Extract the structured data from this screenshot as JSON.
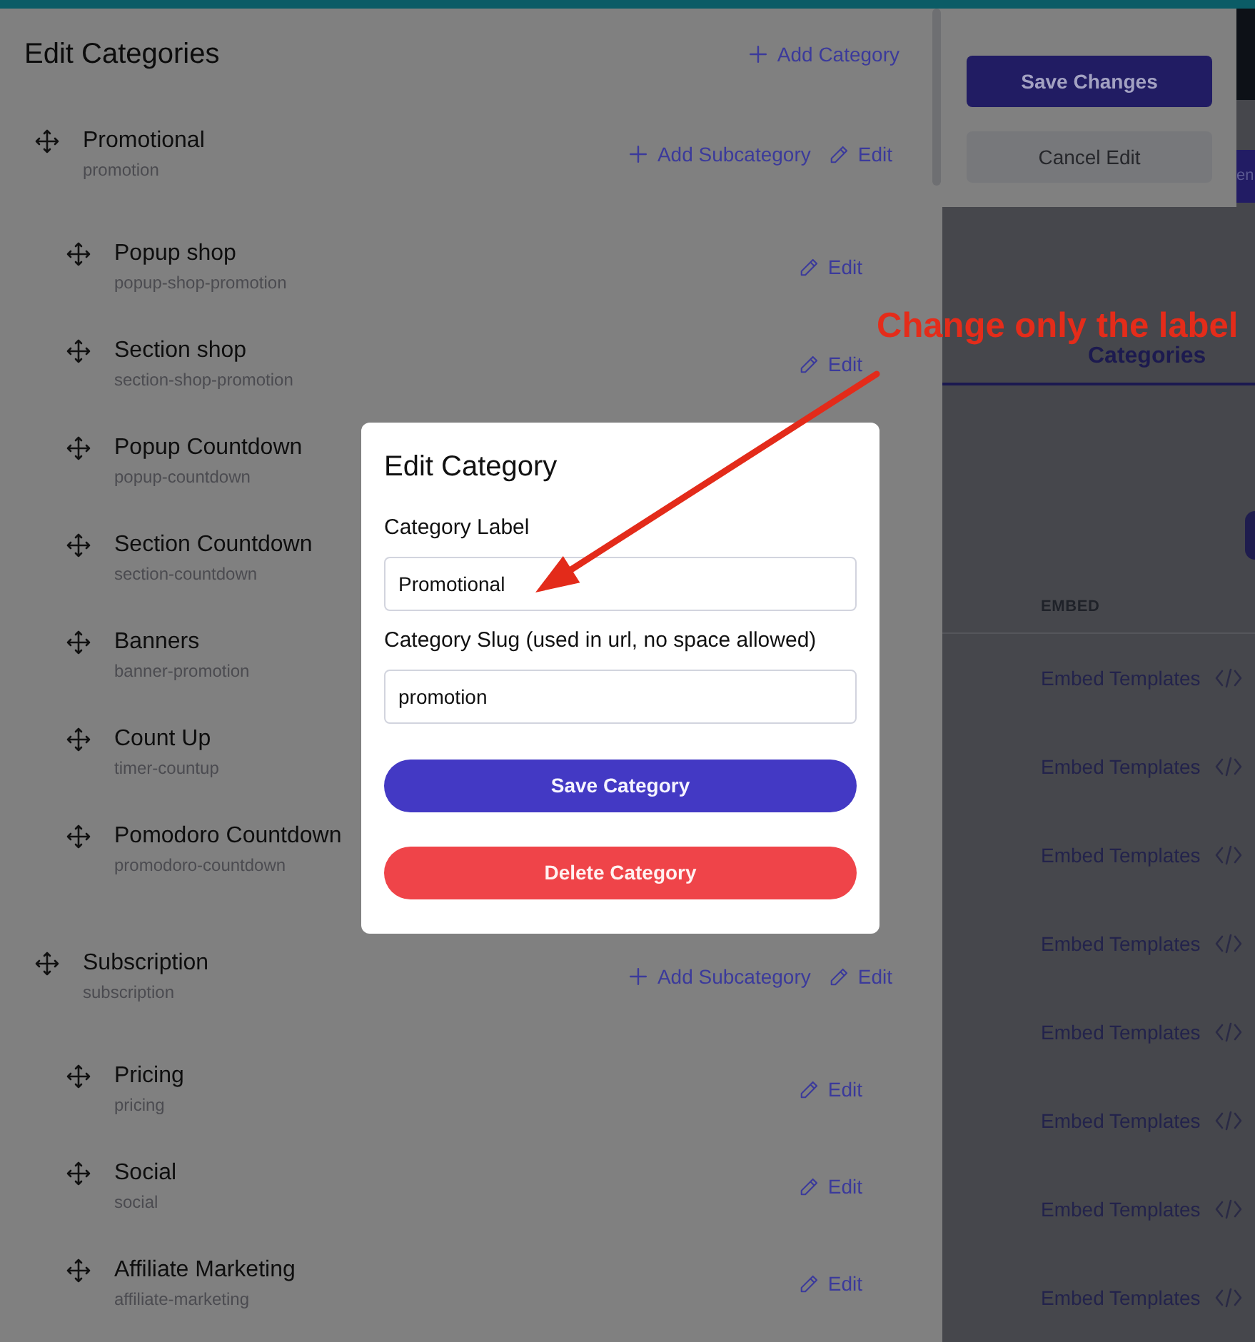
{
  "panel": {
    "title": "Edit Categories",
    "add_label": "Add Category"
  },
  "categories": [
    {
      "name": "Promotional",
      "slug": "promotion",
      "add_label": "Add Subcategory",
      "edit_label": "Edit",
      "children": [
        {
          "name": "Popup shop",
          "slug": "popup-shop-promotion",
          "edit_label": "Edit"
        },
        {
          "name": "Section shop",
          "slug": "section-shop-promotion",
          "edit_label": "Edit"
        },
        {
          "name": "Popup Countdown",
          "slug": "popup-countdown"
        },
        {
          "name": "Section Countdown",
          "slug": "section-countdown"
        },
        {
          "name": "Banners",
          "slug": "banner-promotion"
        },
        {
          "name": "Count Up",
          "slug": "timer-countup"
        },
        {
          "name": "Pomodoro Countdown",
          "slug": "promodoro-countdown"
        }
      ]
    },
    {
      "name": "Subscription",
      "slug": "subscription",
      "add_label": "Add Subcategory",
      "edit_label": "Edit",
      "children": [
        {
          "name": "Pricing",
          "slug": "pricing",
          "edit_label": "Edit"
        },
        {
          "name": "Social",
          "slug": "social",
          "edit_label": "Edit"
        },
        {
          "name": "Affiliate Marketing",
          "slug": "affiliate-marketing",
          "edit_label": "Edit"
        }
      ]
    }
  ],
  "actions": {
    "save": "Save Changes",
    "cancel": "Cancel Edit"
  },
  "edge_button": "en",
  "tabs": [
    {
      "label": "Categories",
      "selected": true
    }
  ],
  "table": {
    "columns": [
      "EMBED"
    ],
    "rows": [
      {
        "embed": "Embed Templates"
      },
      {
        "embed": "Embed Templates"
      },
      {
        "embed": "Embed Templates"
      },
      {
        "embed": "Embed Templates"
      },
      {
        "embed": "Embed Templates"
      },
      {
        "embed": "Embed Templates"
      },
      {
        "embed": "Embed Templates"
      },
      {
        "embed": "Embed Templates"
      }
    ]
  },
  "modal": {
    "title": "Edit Category",
    "fields": [
      {
        "label": "Category Label",
        "value": "Promotional"
      },
      {
        "label": "Category Slug (used in url, no space allowed)",
        "value": "promotion"
      }
    ],
    "buttons": [
      {
        "label": "Save Category",
        "kind": "primary"
      },
      {
        "label": "Delete Category",
        "kind": "danger"
      }
    ]
  },
  "annotation": {
    "text": "Change only the label"
  }
}
